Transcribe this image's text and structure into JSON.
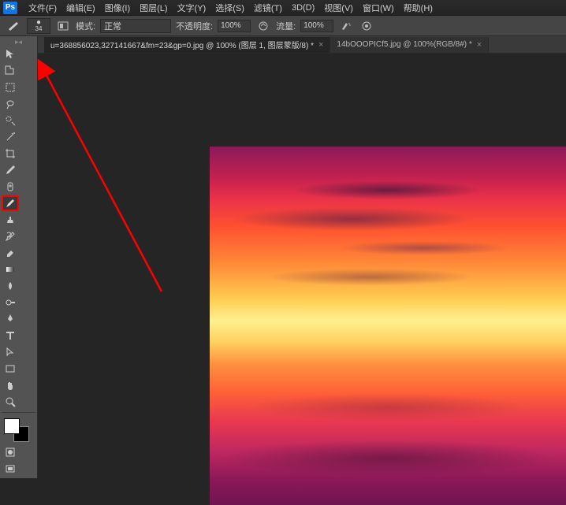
{
  "app": {
    "logo": "Ps"
  },
  "menu": {
    "file": "文件(F)",
    "edit": "编辑(E)",
    "image": "图像(I)",
    "layer": "图层(L)",
    "type": "文字(Y)",
    "select": "选择(S)",
    "filter": "滤镜(T)",
    "threeD": "3D(D)",
    "view": "视图(V)",
    "window": "窗口(W)",
    "help": "帮助(H)"
  },
  "options": {
    "brush_size": "34",
    "mode_label": "模式:",
    "mode_value": "正常",
    "opacity_label": "不透明度:",
    "opacity_value": "100%",
    "flow_label": "流量:",
    "flow_value": "100%"
  },
  "tabs": {
    "tab1_label": "u=368856023,327141667&fm=23&gp=0.jpg @ 100% (图层 1, 图层蒙版/8) *",
    "tab2_label": "14bOOOPICf5.jpg @ 100%(RGB/8#) *"
  },
  "tools": {
    "move": "move-tool",
    "marquee": "marquee-tool",
    "lasso": "lasso-tool",
    "wand": "magic-wand-tool",
    "crop": "crop-tool",
    "eyedropper": "eyedropper-tool",
    "healing": "healing-brush-tool",
    "brush": "brush-tool",
    "stamp": "clone-stamp-tool",
    "history": "history-brush-tool",
    "eraser": "eraser-tool",
    "gradient": "gradient-tool",
    "blur": "blur-tool",
    "dodge": "dodge-tool",
    "pen": "pen-tool",
    "type": "type-tool",
    "path": "path-selection-tool",
    "shape": "shape-tool",
    "hand": "hand-tool",
    "zoom": "zoom-tool"
  },
  "colors": {
    "foreground": "#ffffff",
    "background": "#000000"
  }
}
